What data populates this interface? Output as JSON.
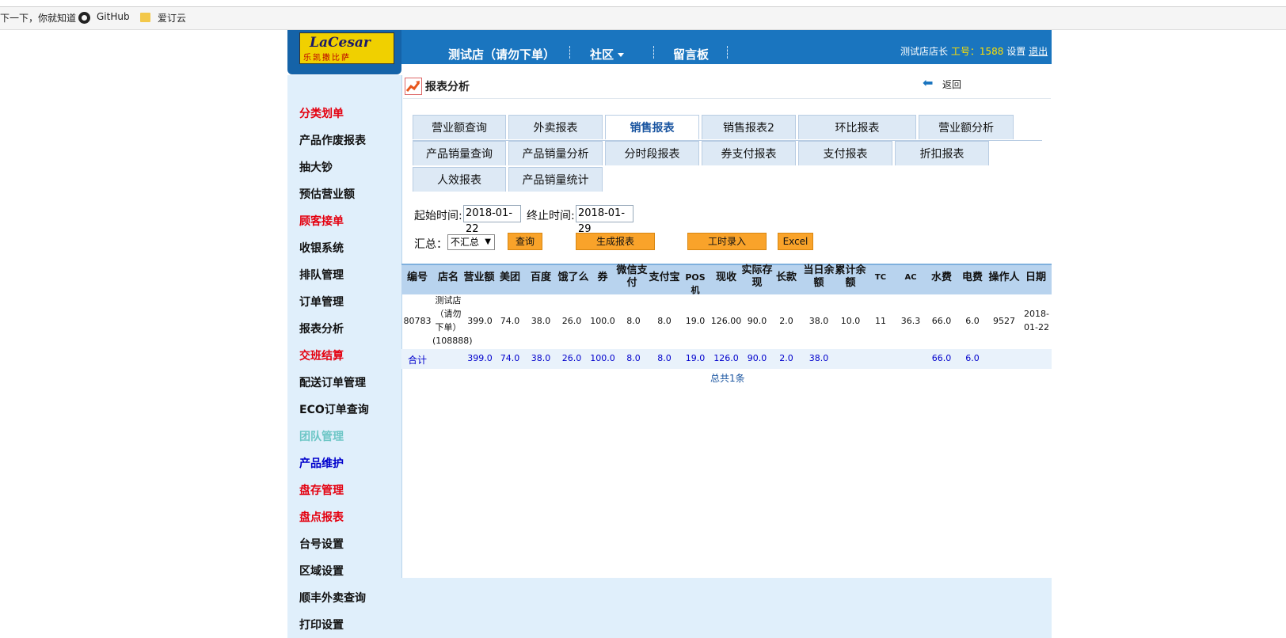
{
  "bookmarks": [
    {
      "label": "下一下，你就知道"
    },
    {
      "label": "GitHub"
    },
    {
      "label": "爱订云"
    }
  ],
  "header": {
    "logo": {
      "brand": "LaCesar",
      "sub": "乐凯撒比萨"
    },
    "nav": [
      {
        "label": "测试店（请勿下单）"
      },
      {
        "label": "社区"
      },
      {
        "label": "留言板"
      }
    ],
    "user": {
      "name": "测试店店长",
      "emp_label": "工号：1588",
      "settings": "设置",
      "logout": "退出"
    }
  },
  "sidebar": {
    "items": [
      {
        "label": "分类划单",
        "color": "#e4000f"
      },
      {
        "label": "产品作废报表",
        "color": "#111111"
      },
      {
        "label": "抽大钞",
        "color": "#111111"
      },
      {
        "label": "预估营业额",
        "color": "#111111"
      },
      {
        "label": "顾客接单",
        "color": "#e4000f"
      },
      {
        "label": "收银系统",
        "color": "#111111"
      },
      {
        "label": "排队管理",
        "color": "#111111"
      },
      {
        "label": "订单管理",
        "color": "#111111"
      },
      {
        "label": "报表分析",
        "color": "#111111"
      },
      {
        "label": "交班结算",
        "color": "#e4000f"
      },
      {
        "label": "配送订单管理",
        "color": "#111111"
      },
      {
        "label": "ECO订单查询",
        "color": "#111111"
      },
      {
        "label": "团队管理",
        "color": "#6dc6c6"
      },
      {
        "label": "产品维护",
        "color": "#0000cc"
      },
      {
        "label": "盘存管理",
        "color": "#e4000f"
      },
      {
        "label": "盘点报表",
        "color": "#e4000f"
      },
      {
        "label": "台号设置",
        "color": "#111111"
      },
      {
        "label": "区域设置",
        "color": "#111111"
      },
      {
        "label": "顺丰外卖查询",
        "color": "#111111"
      },
      {
        "label": "打印设置",
        "color": "#111111"
      }
    ]
  },
  "page": {
    "title": "报表分析",
    "back": "返回"
  },
  "tabs": [
    {
      "label": "营业额查询"
    },
    {
      "label": "外卖报表"
    },
    {
      "label": "销售报表",
      "active": true
    },
    {
      "label": "销售报表2"
    },
    {
      "label": "环比报表"
    },
    {
      "label": "营业额分析"
    },
    {
      "label": "产品销量查询"
    },
    {
      "label": "产品销量分析"
    },
    {
      "label": "分时段报表"
    },
    {
      "label": "券支付报表"
    },
    {
      "label": "支付报表"
    },
    {
      "label": "折扣报表"
    },
    {
      "label": "人效报表"
    },
    {
      "label": "产品销量统计"
    }
  ],
  "form": {
    "start_label": "起始时间:",
    "start_value": "2018-01-22",
    "end_label": "终止时间:",
    "end_value": "2018-01-29",
    "summary_label": "汇总：",
    "summary_value": "不汇总",
    "buttons": {
      "query": "查询",
      "generate": "生成报表",
      "hours": "工时录入",
      "excel": "Excel"
    }
  },
  "table": {
    "headers": [
      "编号",
      "店名",
      "营业额",
      "美团",
      "百度",
      "饿了么",
      "券",
      "微信支付",
      "支付宝",
      "POS机",
      "现收",
      "实际存现",
      "长款",
      "当日余额",
      "累计余额",
      "TC",
      "AC",
      "水费",
      "电费",
      "操作人",
      "日期"
    ],
    "rows": [
      [
        "80783",
        "测试店（请勿下单）(108888)",
        "399.0",
        "74.0",
        "38.0",
        "26.0",
        "100.0",
        "8.0",
        "8.0",
        "19.0",
        "126.00",
        "90.0",
        "2.0",
        "38.0",
        "10.0",
        "11",
        "36.3",
        "66.0",
        "6.0",
        "9527",
        "2018-01-22"
      ]
    ],
    "summary": [
      "合计",
      "",
      "399.0",
      "74.0",
      "38.0",
      "26.0",
      "100.0",
      "8.0",
      "8.0",
      "19.0",
      "126.0",
      "90.0",
      "2.0",
      "38.0",
      "",
      "",
      "",
      "66.0",
      "6.0",
      "",
      ""
    ],
    "total_text": "总共1条"
  }
}
